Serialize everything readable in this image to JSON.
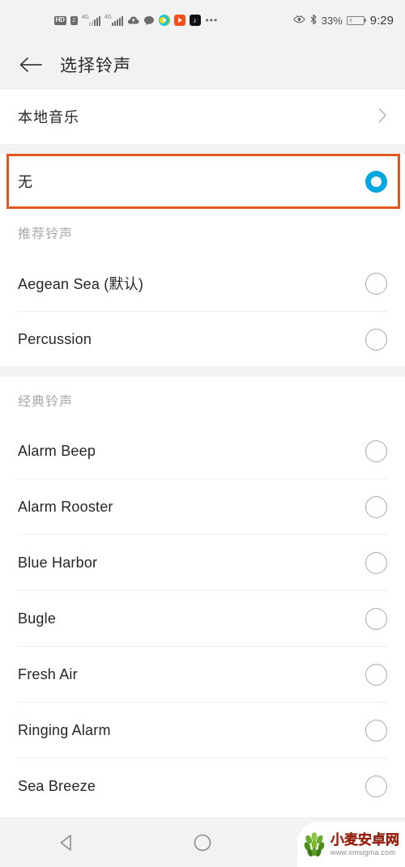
{
  "status_bar": {
    "hd_label": "HD",
    "sim_label": "2",
    "network_1": "4G",
    "network_2": "4G",
    "cloud_icon": "cloud-upload-icon",
    "chat_icon": "chat-bubble-icon",
    "app_icons": [
      "google-play-icon",
      "video-player-icon",
      "tiktok-icon"
    ],
    "tiktok_glyph": "♪",
    "more_icon": "more-dots-icon",
    "eye_icon": "eye-comfort-icon",
    "bluetooth_icon": "bluetooth-icon",
    "battery_percent": "33%",
    "battery_icon": "battery-charging-icon",
    "clock": "9:29"
  },
  "app_bar": {
    "back_icon": "back-arrow-icon",
    "title": "选择铃声"
  },
  "colors": {
    "accent_selected": "#00a7e1",
    "annotation_border": "#e1581f",
    "header_bg": "#f2f2f2",
    "watermark_red": "#d9381e"
  },
  "local_music": {
    "label": "本地音乐",
    "chevron_icon": "chevron-right-icon",
    "chevron_glyph": "›"
  },
  "none_row": {
    "label": "无",
    "selected": true,
    "highlighted": true
  },
  "sections": [
    {
      "title": "推荐铃声",
      "items": [
        {
          "label": "Aegean Sea (默认)",
          "selected": false
        },
        {
          "label": "Percussion",
          "selected": false
        }
      ]
    },
    {
      "title": "经典铃声",
      "items": [
        {
          "label": "Alarm Beep",
          "selected": false
        },
        {
          "label": "Alarm Rooster",
          "selected": false
        },
        {
          "label": "Blue Harbor",
          "selected": false
        },
        {
          "label": "Bugle",
          "selected": false
        },
        {
          "label": "Fresh Air",
          "selected": false
        },
        {
          "label": "Ringing Alarm",
          "selected": false
        },
        {
          "label": "Sea Breeze",
          "selected": false
        }
      ]
    }
  ],
  "nav_bar": {
    "back_icon": "nav-back-triangle-icon",
    "home_icon": "nav-home-circle-icon",
    "recent_icon": "nav-recents-square-icon"
  },
  "watermark": {
    "logo_icon": "wheat-logo-icon",
    "title": "小麦安卓网",
    "url": "www.xmsigma.com"
  }
}
